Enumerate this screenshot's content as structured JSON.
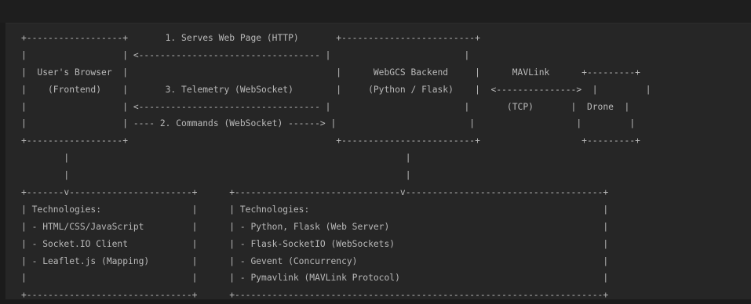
{
  "code_block": {
    "lines": [
      "+------------------+       1. Serves Web Page (HTTP)       +-------------------------+",
      "|                  | <---------------------------------- |                         |",
      "|  User's Browser  |                                       |      WebGCS Backend     |      MAVLink      +---------+",
      "|    (Frontend)    |       3. Telemetry (WebSocket)        |     (Python / Flask)    |  <--------------->  |         |",
      "|                  | <---------------------------------- |                         |       (TCP)       |  Drone  |",
      "|                  | ---- 2. Commands (WebSocket) ------> |                         |                   |         |",
      "+------------------+                                       +-------------------------+                   +---------+",
      "        |                                                               |",
      "        |                                                               |",
      "+-------v-----------------------+      +-------------------------------v-------------------------------------+",
      "| Technologies:                 |      | Technologies:                                                       |",
      "| - HTML/CSS/JavaScript         |      | - Python, Flask (Web Server)                                        |",
      "| - Socket.IO Client            |      | - Flask-SocketIO (WebSockets)                                       |",
      "| - Leaflet.js (Mapping)        |      | - Gevent (Concurrency)                                              |",
      "|                               |      | - Pymavlink (MAVLink Protocol)                                      |",
      "+-------------------------------+      +---------------------------------------------------------------------+"
    ]
  },
  "colors": {
    "page_background": "#1b1b1b",
    "panel_background": "#262626",
    "text": "#b9b9b9"
  }
}
